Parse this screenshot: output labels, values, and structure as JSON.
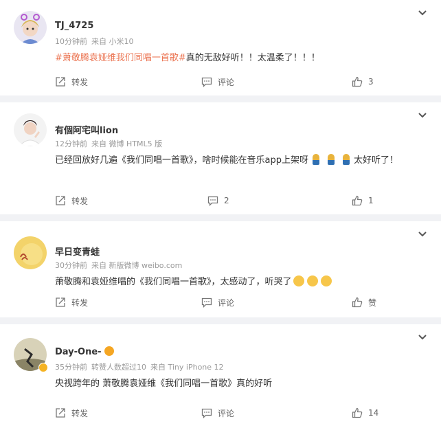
{
  "comments": [
    {
      "username": "TJ_4725",
      "time": "10分钟前",
      "source": "来自 小米10",
      "topic_tag": "#萧敬腾袁娅维我们同唱一首歌#",
      "text": "真的无敌好听！！太温柔了！！！",
      "share_label": "转发",
      "comment_label": "评论",
      "like_label": "3"
    },
    {
      "username": "有個阿宅叫lion",
      "time": "12分钟前",
      "source": "来自 微博 HTML5 版",
      "text": "已经回放好几遍《我们同唱一首歌》，啥时候能在音乐app上架呀",
      "text_suffix": "太好听了！",
      "share_label": "转发",
      "comment_label": "2",
      "like_label": "1"
    },
    {
      "username": "早日变青蛙",
      "time": "30分钟前",
      "source": "来自 新版微博 weibo.com",
      "text": "萧敬腾和袁娅维唱的《我们同唱一首歌》，太感动了，听哭了",
      "share_label": "转发",
      "comment_label": "评论",
      "like_label": "赞"
    },
    {
      "username": "Day-One-",
      "time": "35分钟前",
      "reposts": "转赞人数超过10",
      "source": "来自 Tiny iPhone 12",
      "text": "央视跨年的 萧敬腾袁娅维《我们同唱一首歌》真的好听",
      "share_label": "转发",
      "comment_label": "评论",
      "like_label": "14"
    }
  ],
  "icons": {
    "share": "share-icon",
    "comment": "comment-icon",
    "like": "thumbs-up-icon",
    "more": "chevron-down-icon"
  },
  "colors": {
    "tag": "#eb7350",
    "background": "#f1f2f5",
    "muted": "#999999"
  }
}
